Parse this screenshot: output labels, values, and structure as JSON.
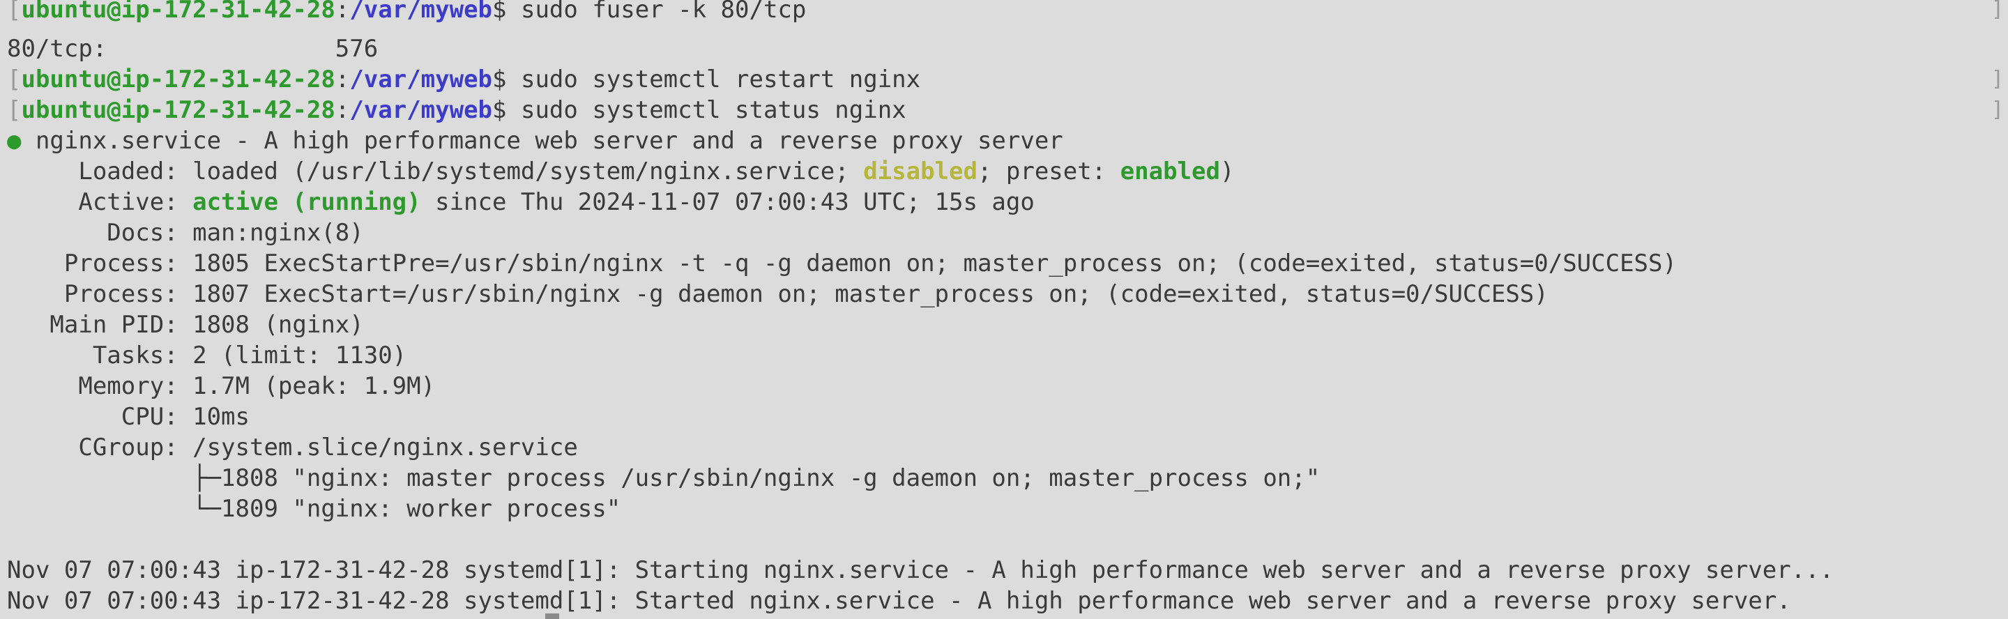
{
  "colors": {
    "background": "#dcdcdc",
    "text": "#3a3a3a",
    "prompt_user": "#2e9a2e",
    "prompt_path": "#3c3cc8",
    "status_green": "#2e9a2e",
    "status_yellow": "#b6b63a"
  },
  "prompt": {
    "user_host": "ubuntu@ip-172-31-42-28",
    "colon": ":",
    "path": "/var/myweb",
    "symbol": "$"
  },
  "commands": {
    "cmd1": " sudo fuser -k 80/tcp",
    "cmd2": " sudo systemctl restart nginx",
    "cmd3": " sudo systemctl status nginx"
  },
  "fuser_output": "80/tcp:                576",
  "status": {
    "dot": "●",
    "service_line": " nginx.service - A high performance web server and a reverse proxy server",
    "loaded_prefix": "     Loaded: loaded (/usr/lib/systemd/system/nginx.service; ",
    "loaded_disabled": "disabled",
    "loaded_mid": "; preset: ",
    "loaded_enabled": "enabled",
    "loaded_suffix": ")",
    "active_prefix": "     Active: ",
    "active_state": "active (running)",
    "active_suffix": " since Thu 2024-11-07 07:00:43 UTC; 15s ago",
    "docs": "       Docs: man:nginx(8)",
    "process1": "    Process: 1805 ExecStartPre=/usr/sbin/nginx -t -q -g daemon on; master_process on; (code=exited, status=0/SUCCESS)",
    "process2": "    Process: 1807 ExecStart=/usr/sbin/nginx -g daemon on; master_process on; (code=exited, status=0/SUCCESS)",
    "main_pid": "   Main PID: 1808 (nginx)",
    "tasks": "      Tasks: 2 (limit: 1130)",
    "memory": "     Memory: 1.7M (peak: 1.9M)",
    "cpu": "        CPU: 10ms",
    "cgroup": "     CGroup: /system.slice/nginx.service",
    "tree1": "             ├─1808 \"nginx: master process /usr/sbin/nginx -g daemon on; master_process on;\"",
    "tree2": "             └─1809 \"nginx: worker process\""
  },
  "logs": {
    "log1": "Nov 07 07:00:43 ip-172-31-42-28 systemd[1]: Starting nginx.service - A high performance web server and a reverse proxy server...",
    "log2": "Nov 07 07:00:43 ip-172-31-42-28 systemd[1]: Started nginx.service - A high performance web server and a reverse proxy server."
  },
  "brackets": {
    "left": "[",
    "right": "]"
  }
}
